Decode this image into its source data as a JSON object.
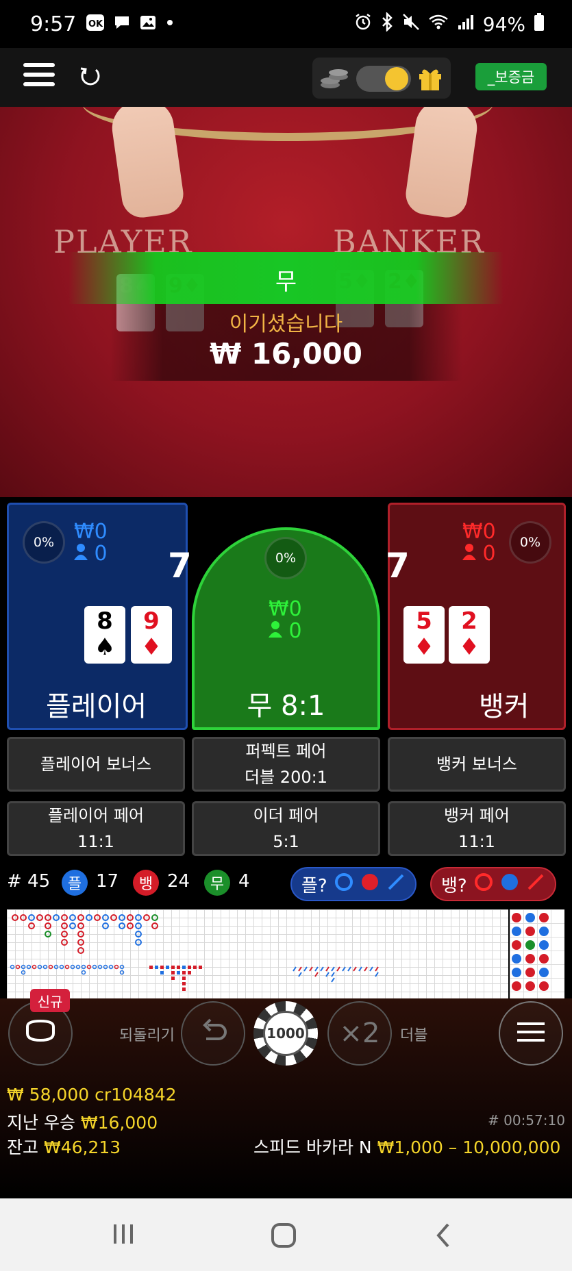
{
  "status_bar": {
    "time": "9:57",
    "notification_icons": [
      "ok-app-icon",
      "chat-icon",
      "image-icon",
      "dot-icon"
    ],
    "system_icons": [
      "alarm-icon",
      "bluetooth-icon",
      "mute-icon",
      "wifi-icon",
      "signal-icon"
    ],
    "battery": "94%"
  },
  "top_bar": {
    "menu_icon": "hamburger-icon",
    "refresh_icon": "refresh-icon",
    "toggle_on": true,
    "deposit_label": "_보증금"
  },
  "table_view": {
    "player_label": "PLAYER",
    "banker_label": "BANKER",
    "result_text": "무",
    "win_message": "이기셨습니다",
    "win_amount": "₩ 16,000",
    "player_cards": [
      {
        "rank": "8",
        "suit": "♠",
        "color": "#000"
      },
      {
        "rank": "9",
        "suit": "♦",
        "color": "#e01020"
      }
    ],
    "banker_cards": [
      {
        "rank": "5",
        "suit": "♦",
        "color": "#e01020"
      },
      {
        "rank": "2",
        "suit": "♦",
        "color": "#e01020"
      }
    ]
  },
  "bets": {
    "player": {
      "pct": "0%",
      "amount": "₩0",
      "users": "0",
      "score": "7",
      "label": "플레이어"
    },
    "tie": {
      "pct": "0%",
      "amount": "₩0",
      "users": "0",
      "label": "무 8:1"
    },
    "banker": {
      "pct": "0%",
      "amount": "₩0",
      "users": "0",
      "score": "7",
      "label": "뱅커"
    }
  },
  "side_bets": {
    "player_bonus": "플레이어 보너스",
    "perfect_pair_line1": "퍼펙트 페어",
    "perfect_pair_line2": "더블 200:1",
    "banker_bonus": "뱅커 보너스",
    "player_pair_line1": "플레이어 페어",
    "player_pair_line2": "11:1",
    "either_pair_line1": "이더 페어",
    "either_pair_line2": "5:1",
    "banker_pair_line1": "뱅커 페어",
    "banker_pair_line2": "11:1"
  },
  "stats": {
    "round": "# 45",
    "player_tag": "플",
    "player_count": "17",
    "banker_tag": "뱅",
    "banker_count": "24",
    "tie_tag": "무",
    "tie_count": "4",
    "player_predict": "플?",
    "banker_predict": "뱅?"
  },
  "controls": {
    "new_badge": "신규",
    "undo_label": "되돌리기",
    "chip_value": "1000",
    "double_symbol": "×2",
    "double_label": "더블"
  },
  "footer": {
    "balance_line": "₩ 58,000 cr104842",
    "last_win_label": "지난 우승",
    "last_win_amount": "₩16,000",
    "balance_label": "잔고",
    "balance_amount": "₩46,213",
    "timer": "# 00:57:10",
    "table_name": "스피드 바카라 N",
    "limits": "₩1,000 – 10,000,000"
  },
  "colors": {
    "player_blue": "#1f4fb0",
    "banker_red": "#b0202a",
    "tie_green": "#2ed33a",
    "accent_yellow": "#f5d52a"
  }
}
